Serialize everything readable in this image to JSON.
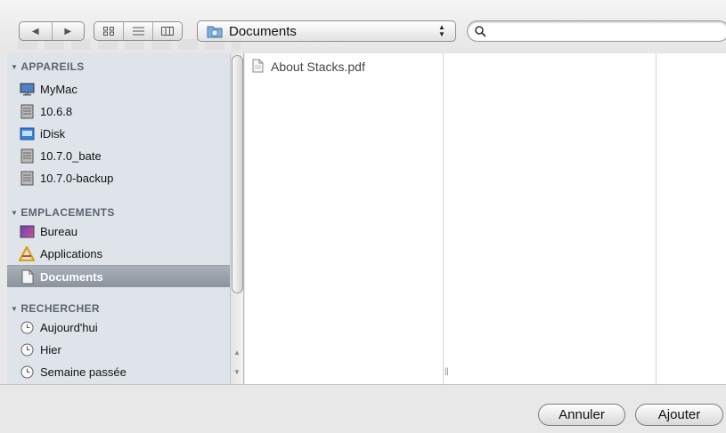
{
  "toolbar": {
    "back_label": "◀",
    "forward_label": "▶",
    "view_icons": [
      "icon-view-icon",
      "list-view-icon",
      "column-view-icon"
    ],
    "path_popup": {
      "label": "Documents",
      "icon": "documents-folder-icon"
    },
    "search": {
      "value": "",
      "placeholder": ""
    }
  },
  "sidebar": {
    "sections": [
      {
        "title": "APPAREILS",
        "items": [
          {
            "label": "MyMac",
            "icon": "computer-icon"
          },
          {
            "label": "10.6.8",
            "icon": "hard-drive-icon"
          },
          {
            "label": "iDisk",
            "icon": "idisk-icon"
          },
          {
            "label": "10.7.0_bate",
            "icon": "hard-drive-icon"
          },
          {
            "label": "10.7.0-backup",
            "icon": "hard-drive-icon"
          }
        ]
      },
      {
        "title": "EMPLACEMENTS",
        "items": [
          {
            "label": "Bureau",
            "icon": "desktop-icon"
          },
          {
            "label": "Applications",
            "icon": "applications-icon"
          },
          {
            "label": "Documents",
            "icon": "documents-icon",
            "selected": true
          }
        ]
      },
      {
        "title": "RECHERCHER",
        "items": [
          {
            "label": "Aujourd'hui",
            "icon": "clock-icon"
          },
          {
            "label": "Hier",
            "icon": "clock-icon"
          },
          {
            "label": "Semaine passée",
            "icon": "clock-icon"
          }
        ]
      }
    ]
  },
  "browser": {
    "files": [
      {
        "name": "About Stacks.pdf",
        "icon": "pdf-file-icon"
      }
    ]
  },
  "buttons": {
    "cancel": "Annuler",
    "add": "Ajouter"
  },
  "colors": {
    "sidebar_bg": "#dfe4ea",
    "selection": "#8b939d",
    "section_title": "#5a6470"
  }
}
